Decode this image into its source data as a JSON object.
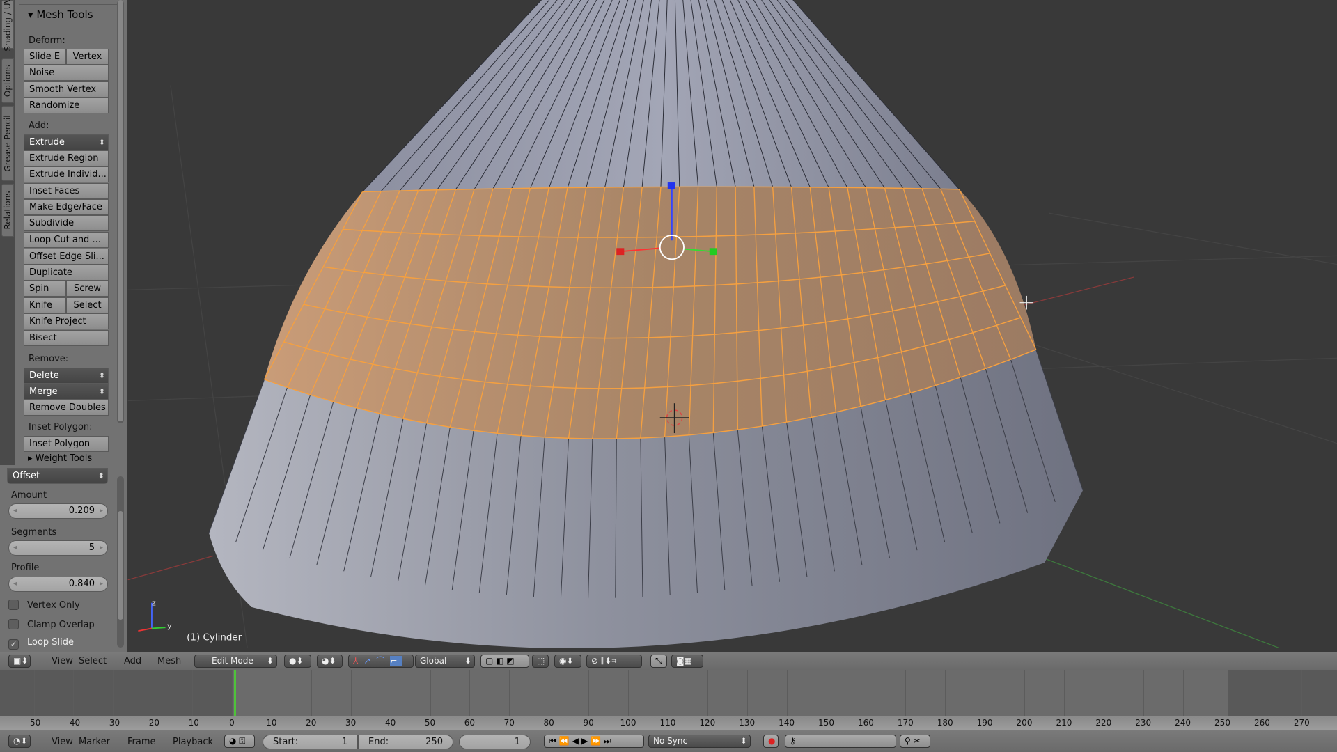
{
  "side_tabs": [
    "Shading / UV",
    "Options",
    "Grease Pencil",
    "Relations"
  ],
  "mesh_tools": {
    "title": "Mesh Tools",
    "deform_label": "Deform:",
    "slide_edge": "Slide E",
    "vertex": "Vertex",
    "noise": "Noise",
    "smooth_vertex": "Smooth Vertex",
    "randomize": "Randomize",
    "add_label": "Add:",
    "extrude": "Extrude",
    "extrude_region": "Extrude Region",
    "extrude_individual": "Extrude Individ...",
    "inset_faces": "Inset Faces",
    "make_edge_face": "Make Edge/Face",
    "subdivide": "Subdivide",
    "loop_cut": "Loop Cut and ...",
    "offset_edge": "Offset Edge Sli...",
    "duplicate": "Duplicate",
    "spin": "Spin",
    "screw": "Screw",
    "knife": "Knife",
    "select": "Select",
    "knife_project": "Knife Project",
    "bisect": "Bisect",
    "remove_label": "Remove:",
    "delete": "Delete",
    "merge": "Merge",
    "remove_doubles": "Remove Doubles",
    "inset_polygon_label": "Inset Polygon:",
    "inset_polygon": "Inset Polygon",
    "weight_tools": "Weight Tools"
  },
  "operator": {
    "mode": "Offset",
    "amount_label": "Amount",
    "amount": "0.209",
    "segments_label": "Segments",
    "segments": "5",
    "profile_label": "Profile",
    "profile": "0.840",
    "vertex_only": {
      "label": "Vertex Only",
      "checked": false
    },
    "clamp_overlap": {
      "label": "Clamp Overlap",
      "checked": false
    },
    "loop_slide": {
      "label": "Loop Slide",
      "checked": true
    }
  },
  "viewport": {
    "object_label": "(1) Cylinder",
    "axis_labels": {
      "x": "x",
      "y": "y",
      "z": "z"
    },
    "selection_color": "#f5a040",
    "background": "#393939"
  },
  "view3d_header": {
    "menus": [
      "View",
      "Select",
      "Add",
      "Mesh"
    ],
    "mode": "Edit Mode",
    "orientation": "Global"
  },
  "timeline": {
    "ticks": [
      -50,
      -40,
      -30,
      -20,
      -10,
      0,
      10,
      20,
      30,
      40,
      50,
      60,
      70,
      80,
      90,
      100,
      110,
      120,
      130,
      140,
      150,
      160,
      170,
      180,
      190,
      200,
      210,
      220,
      230,
      240,
      250,
      260,
      270
    ],
    "current_frame_color": "#4fc23a"
  },
  "timeline_header": {
    "menus": [
      "View",
      "Marker",
      "Frame",
      "Playback"
    ],
    "start_label": "Start:",
    "start": "1",
    "end_label": "End:",
    "end": "250",
    "current": "1",
    "sync": "No Sync"
  }
}
